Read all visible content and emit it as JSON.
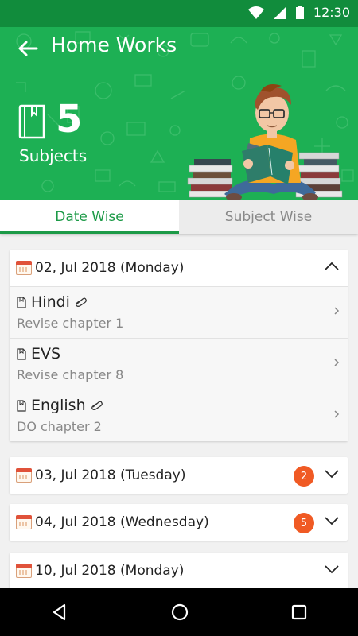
{
  "status_bar": {
    "time": "12:30",
    "icons": [
      "wifi-icon",
      "signal-icon",
      "battery-icon"
    ]
  },
  "header": {
    "title": "Home Works",
    "subject_count": "5",
    "subject_label": "Subjects"
  },
  "tabs": [
    {
      "label": "Date Wise",
      "active": true
    },
    {
      "label": "Subject Wise",
      "active": false
    }
  ],
  "days": [
    {
      "date": "02, Jul 2018 (Monday)",
      "expanded": true,
      "items": [
        {
          "subject": "Hindi",
          "task": "Revise chapter 1",
          "attachment": true
        },
        {
          "subject": "EVS",
          "task": "Revise chapter 8",
          "attachment": false
        },
        {
          "subject": "English",
          "task": "DO chapter 2",
          "attachment": true
        }
      ]
    },
    {
      "date": "03, Jul 2018 (Tuesday)",
      "expanded": false,
      "badge": "2"
    },
    {
      "date": "04, Jul 2018 (Wednesday)",
      "expanded": false,
      "badge": "5"
    },
    {
      "date": "10, Jul 2018 (Monday)",
      "expanded": false
    }
  ],
  "colors": {
    "primary": "#1db054",
    "status_bar": "#118c3c",
    "tab_active": "#1c9a47",
    "badge": "#f05a24"
  },
  "nav_bar": {
    "icons": [
      "back-triangle-icon",
      "home-circle-icon",
      "recents-square-icon"
    ]
  }
}
